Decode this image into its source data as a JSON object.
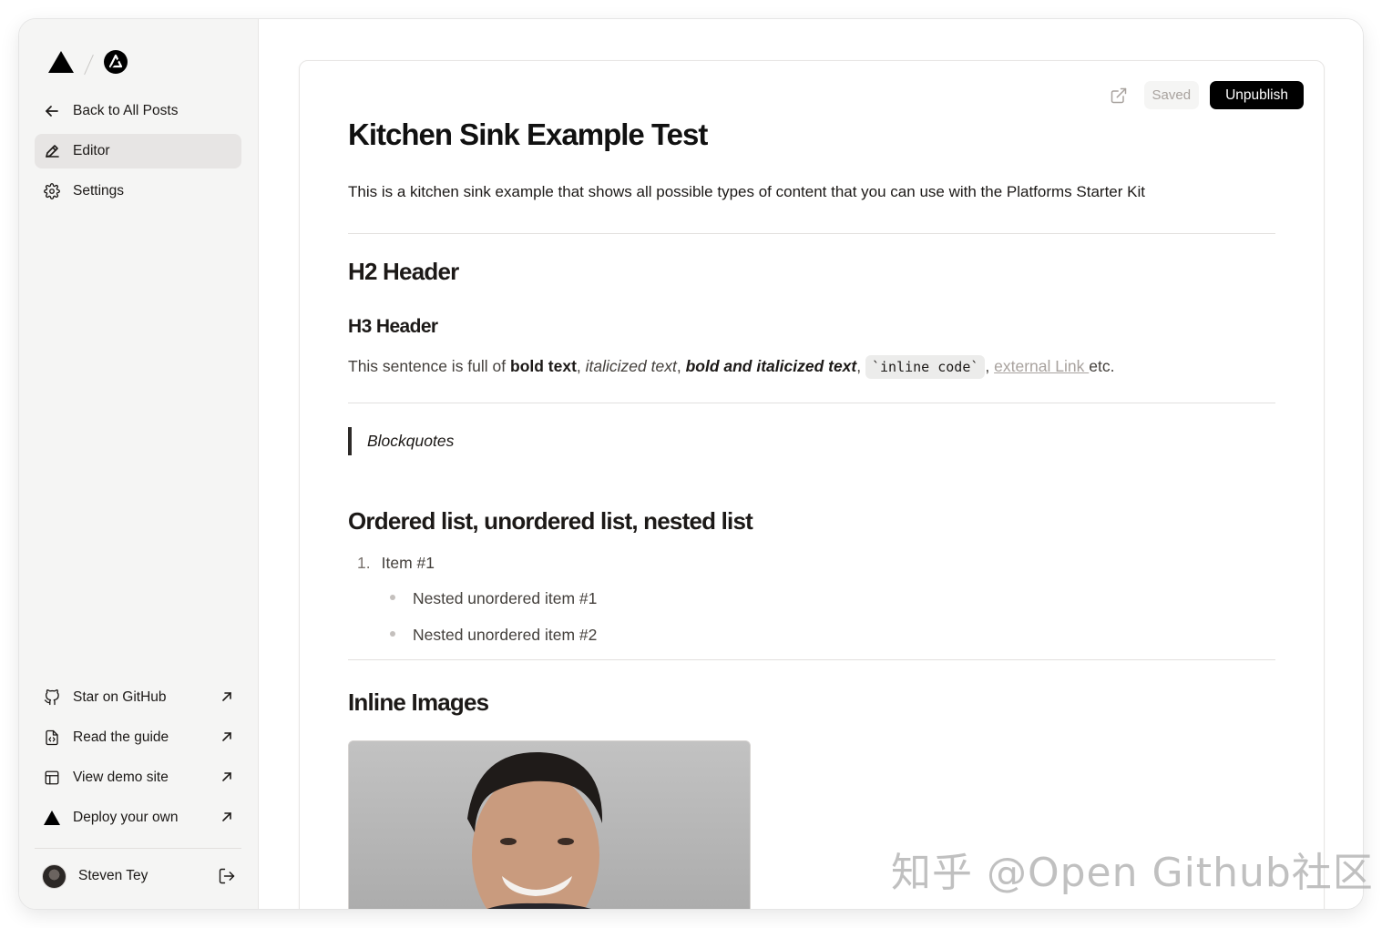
{
  "sidebar": {
    "nav": [
      {
        "label": "Back to All Posts",
        "icon": "arrow-left-icon"
      },
      {
        "label": "Editor",
        "icon": "pencil-icon",
        "active": true
      },
      {
        "label": "Settings",
        "icon": "gear-icon"
      }
    ],
    "external": [
      {
        "label": "Star on GitHub",
        "icon": "github-icon"
      },
      {
        "label": "Read the guide",
        "icon": "document-code-icon"
      },
      {
        "label": "View demo site",
        "icon": "layout-icon"
      },
      {
        "label": "Deploy your own",
        "icon": "triangle-icon"
      }
    ],
    "user": {
      "name": "Steven Tey"
    }
  },
  "toolbar": {
    "status": "Saved",
    "publish_label": "Unpublish"
  },
  "document": {
    "title": "Kitchen Sink Example Test",
    "description": "This is a kitchen sink example that shows all possible types of content that you can use with the Platforms Starter Kit",
    "h2_header": "H2 Header",
    "h3_header": "H3 Header",
    "sentence": {
      "prefix": "This sentence is full of ",
      "bold": "bold text",
      "sep1": ", ",
      "italic": "italicized text",
      "sep2": ", ",
      "bold_italic": "bold and italicized text",
      "sep3": ", ",
      "code": "`inline code`",
      "sep4": ", ",
      "link": "external Link ",
      "suffix": "etc."
    },
    "blockquote": "Blockquotes",
    "lists_header": "Ordered list, unordered list, nested list",
    "ordered_items": [
      {
        "number": "1.",
        "text": "Item #1"
      }
    ],
    "nested_items": [
      "Nested unordered item #1",
      "Nested unordered item #2"
    ],
    "images_header": "Inline Images"
  },
  "watermark": "知乎 @Open Github社区",
  "colors": {
    "sidebar_bg": "#f5f5f4",
    "active_bg": "#e7e5e4",
    "publish_bg": "#000000",
    "saved_text": "#a8a29e",
    "link": "#a8a29e"
  }
}
